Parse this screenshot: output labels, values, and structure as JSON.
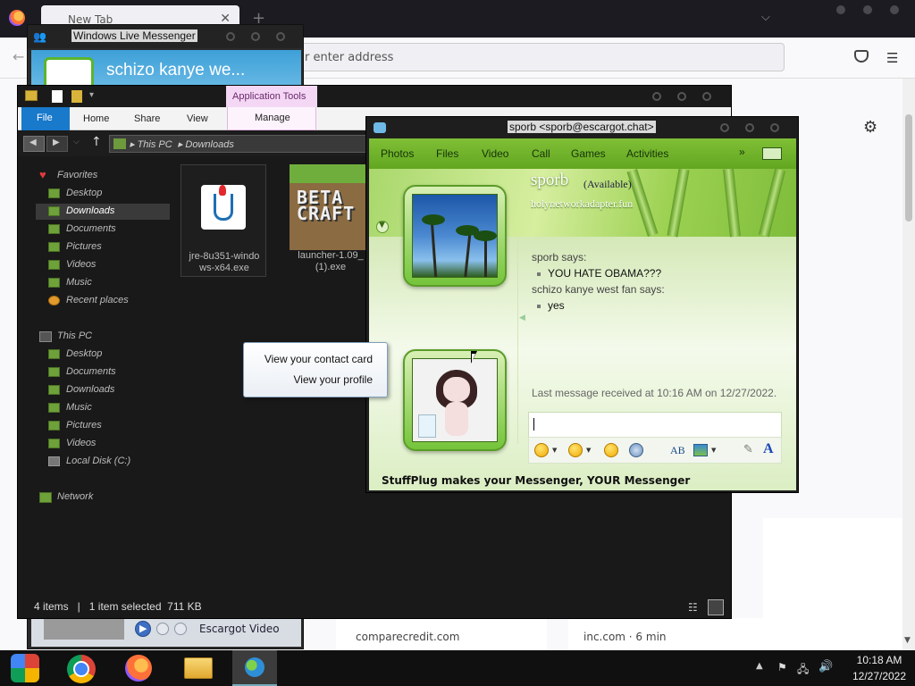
{
  "browser": {
    "tab_title": "New Tab",
    "url_placeholder": "r enter address",
    "tiles": [
      "comparecredit.com",
      "inc.com · 6 min"
    ]
  },
  "messenger_main": {
    "window_title": "Windows Live Messenger",
    "display_name": "schizo kanye we...",
    "video_label": "Escargot Video"
  },
  "explorer": {
    "app_tools_label": "Application Tools",
    "tabs": [
      "File",
      "Home",
      "Share",
      "View",
      "Manage"
    ],
    "breadcrumb": [
      "This PC",
      "Downloads"
    ],
    "sidebar": {
      "favorites_header": "Favorites",
      "favorites": [
        "Desktop",
        "Downloads",
        "Documents",
        "Pictures",
        "Videos",
        "Music",
        "Recent places"
      ],
      "this_pc_header": "This PC",
      "this_pc": [
        "Desktop",
        "Documents",
        "Downloads",
        "Music",
        "Pictures",
        "Videos",
        "Local Disk (C:)"
      ],
      "network": "Network"
    },
    "files": [
      {
        "name_line1": "jre-8u351-windo",
        "name_line2": "ws-x64.exe",
        "icon": "java-icon"
      },
      {
        "name_line1": "launcher-1.09_",
        "name_line2": "(1).exe",
        "icon": "betacraft-icon",
        "logo_line1": "BETA",
        "logo_line2": "CRAFT"
      }
    ],
    "status": "4 items   |   1 item selected  711 KB",
    "selected_item": "Downloads"
  },
  "conversation": {
    "window_title": "sporb <sporb@escargot.chat>",
    "toolbar": [
      "Photos",
      "Files",
      "Video",
      "Call",
      "Games",
      "Activities"
    ],
    "more_glyph": "»",
    "contact_name": "sporb",
    "contact_status": "(Available)",
    "contact_psm": "holynetworkadapter.fun",
    "messages": [
      {
        "from": "sporb says:",
        "text": "YOU HATE OBAMA???"
      },
      {
        "from": "schizo kanye west fan says:",
        "text": "yes"
      }
    ],
    "last_message": "Last message received at 10:16 AM on 12/27/2022.",
    "footer": "StuffPlug makes your Messenger, YOUR Messenger"
  },
  "context_menu": {
    "items": [
      "View your contact card",
      "View your profile"
    ]
  },
  "taskbar": {
    "time": "10:18 AM",
    "date": "12/27/2022"
  },
  "colors": {
    "msn_green": "#62a620",
    "explorer_dark": "#191919",
    "ribbon_file_blue": "#1979ca",
    "app_tools_pink": "#f4d7f5"
  }
}
